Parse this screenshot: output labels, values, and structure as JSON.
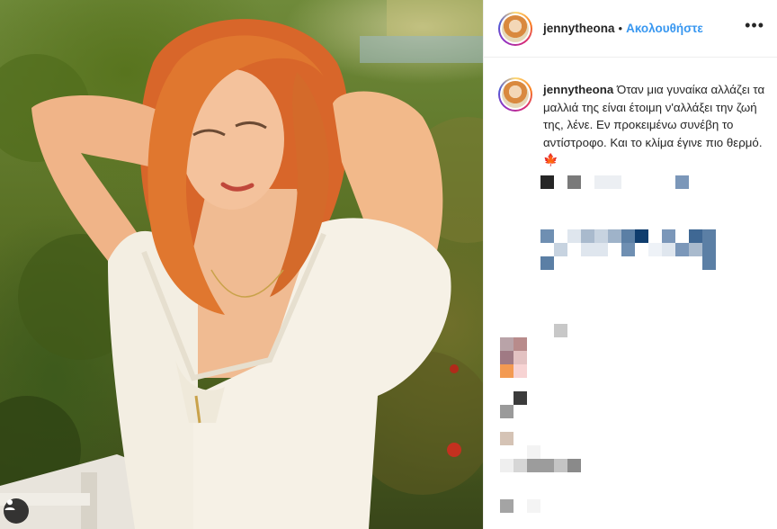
{
  "post": {
    "username": "jennytheona",
    "separator": "•",
    "follow_label": "Ακολουθήστε",
    "more_icon": "more-horizontal-icon",
    "caption": "Όταν μια γυναίκα αλλάζει τα μαλλιά της είναι έτοιμη ν'αλλάξει την ζωή της, λένε. Εν προκειμένω συνέβη το αντίστροφο. Και το κλίμα έγινε πιο θερμό. 🍁"
  },
  "photo": {
    "tag_icon": "person-tag-icon"
  },
  "colors": {
    "follow_blue": "#3897f0",
    "text": "#262626",
    "divider": "#efefef",
    "hair": "#e0772f"
  }
}
